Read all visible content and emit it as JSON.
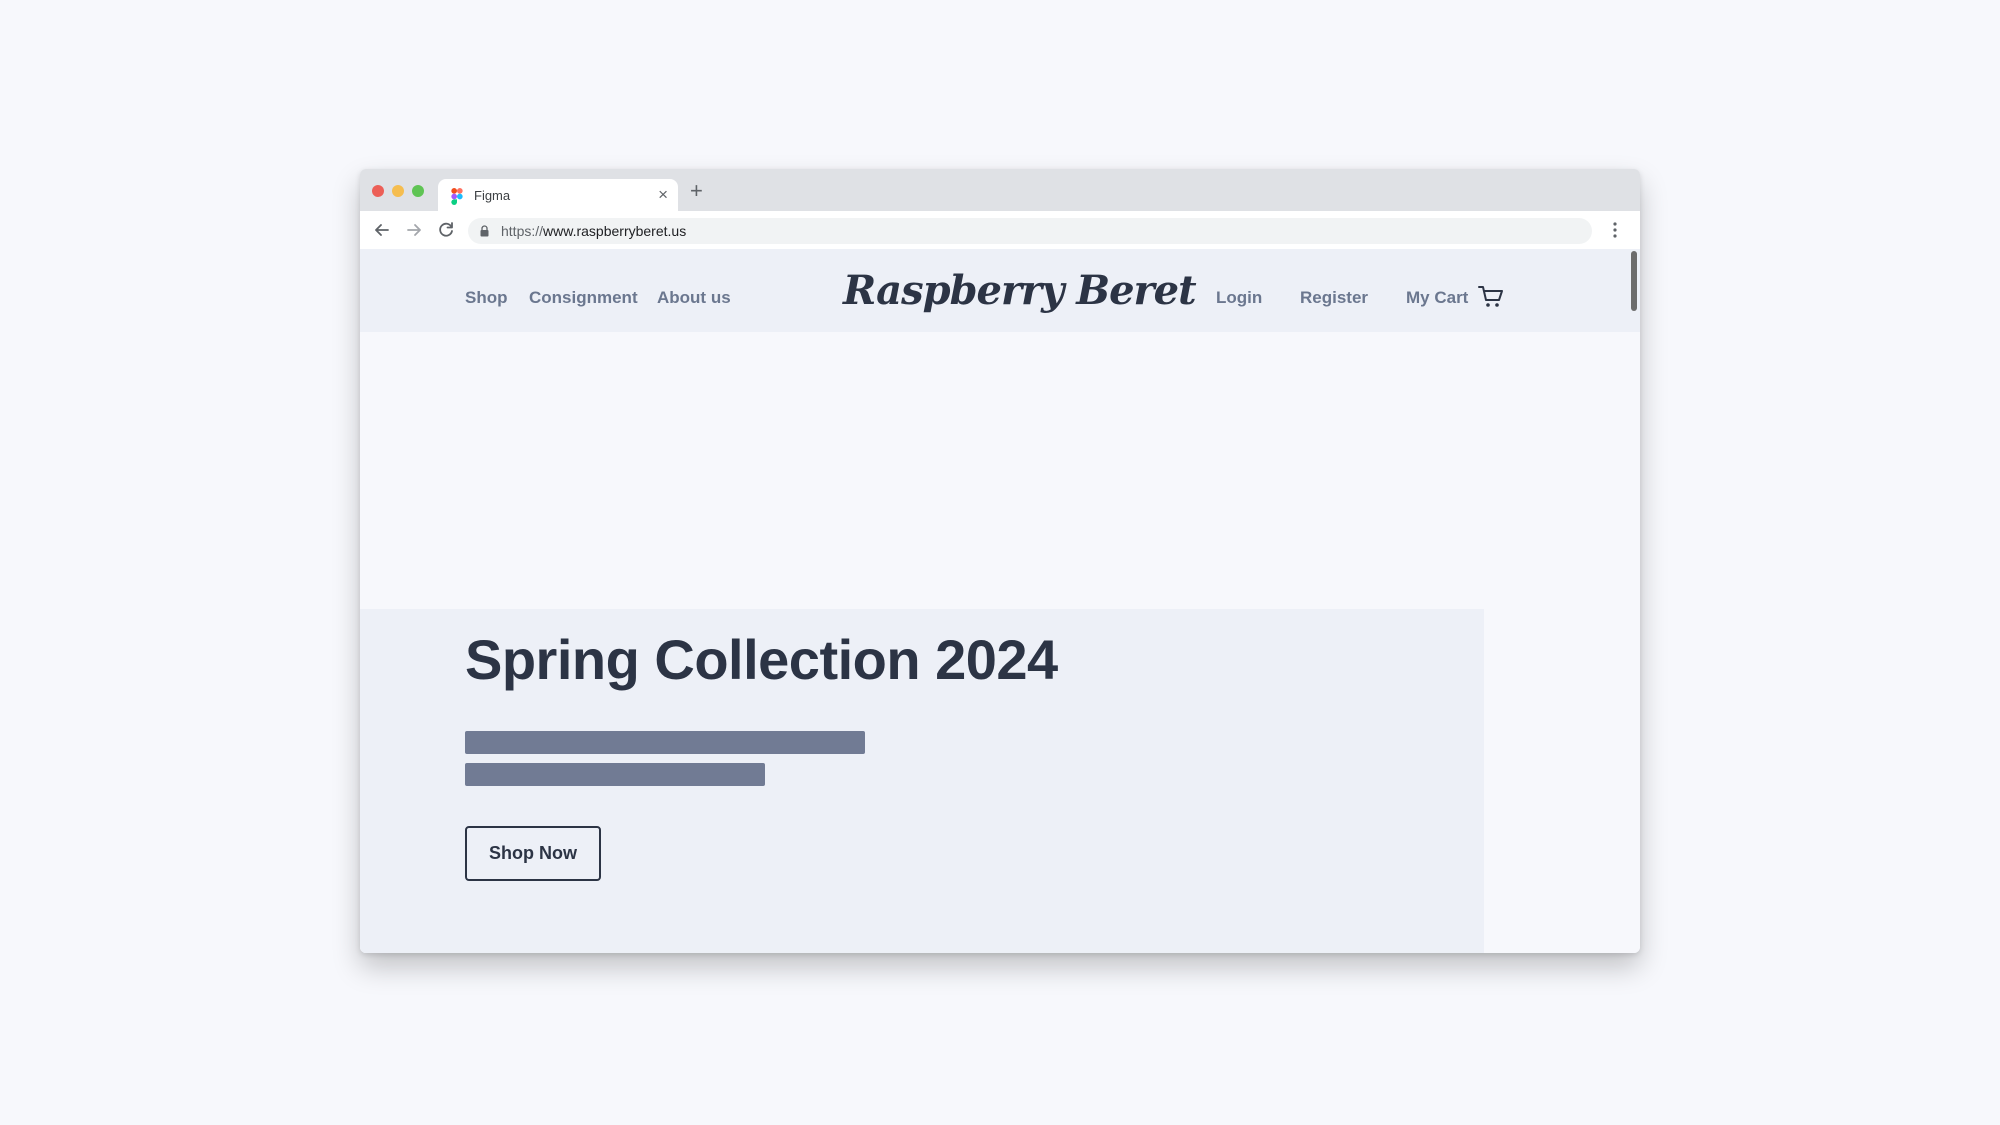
{
  "browser": {
    "tab": {
      "title": "Figma",
      "favicon": "figma-logo-icon"
    },
    "new_tab": "+",
    "close": "×",
    "address": {
      "scheme": "https://",
      "host": "www.raspberryberet.us"
    }
  },
  "site": {
    "nav_left": [
      "Shop",
      "Consignment",
      "About us"
    ],
    "logo": "Raspberry Beret",
    "nav_right": {
      "login": "Login",
      "register": "Register",
      "cart": "My Cart"
    },
    "cart_icon": "shopping-cart-icon"
  },
  "hero": {
    "title": "Spring Collection 2024",
    "cta": "Shop Now"
  },
  "colors": {
    "page_bg": "#f7f8fc",
    "header_bg": "#edf0f7",
    "text_dark": "#2c3445",
    "nav_text": "#6b778f",
    "placeholder_bar": "#717b94"
  }
}
